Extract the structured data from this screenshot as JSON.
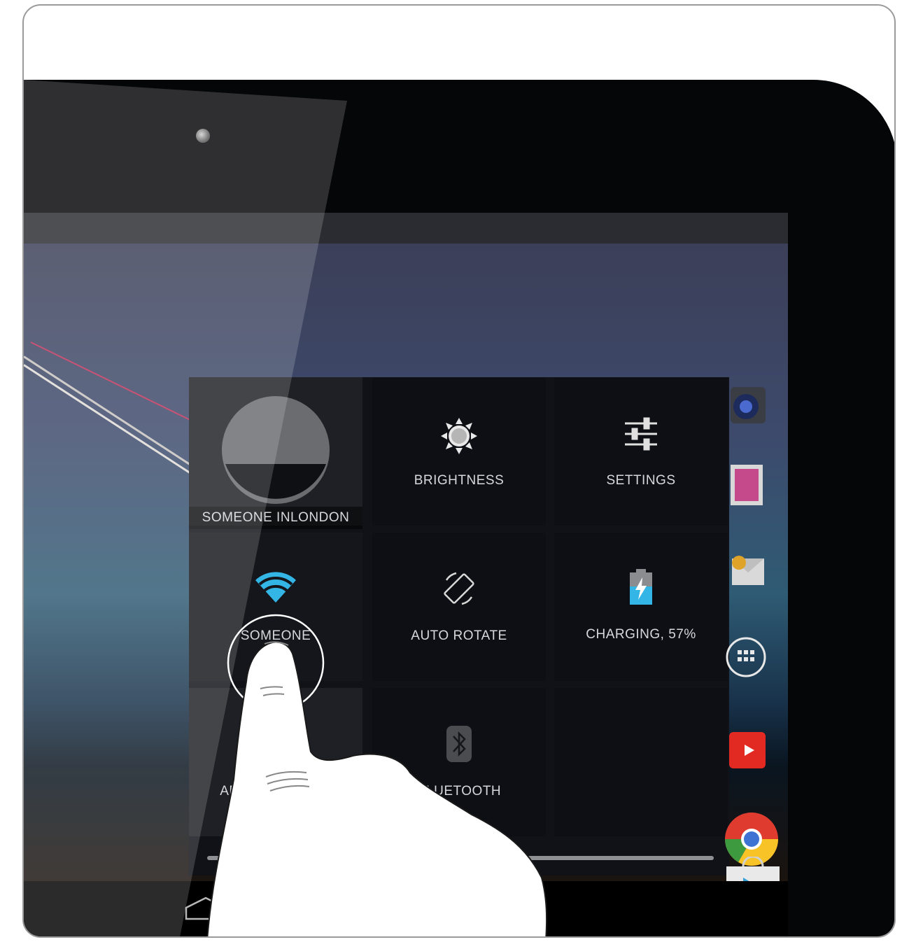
{
  "quick_settings": {
    "user": {
      "label": "SOMEONE INLONDON"
    },
    "brightness": {
      "label": "BRIGHTNESS"
    },
    "settings": {
      "label": "SETTINGS"
    },
    "wifi": {
      "label": "SOMEONE"
    },
    "auto_rotate": {
      "label": "AUTO ROTATE"
    },
    "battery": {
      "label": "CHARGING, 57%",
      "level_percent": 57
    },
    "airplane": {
      "label": "AEROPLANE MODE",
      "visible_label": "AER      MODE"
    },
    "bluetooth": {
      "label": "BLUETOOTH"
    }
  },
  "icons": {
    "user": "user-avatar-icon",
    "brightness": "sun-icon",
    "settings": "sliders-icon",
    "wifi": "wifi-icon",
    "auto_rotate": "rotate-icon",
    "battery": "battery-charging-icon",
    "airplane": "airplane-icon",
    "bluetooth": "bluetooth-icon",
    "dock": [
      "camera-app-icon",
      "gallery-app-icon",
      "email-app-icon",
      "app-drawer-icon",
      "youtube-app-icon",
      "chrome-app-icon",
      "play-store-icon"
    ]
  },
  "colors": {
    "wifi_accent": "#33b5e5",
    "battery_accent": "#33b5e5",
    "panel_bg": "#101217",
    "tile_text": "#d6d8dc"
  }
}
